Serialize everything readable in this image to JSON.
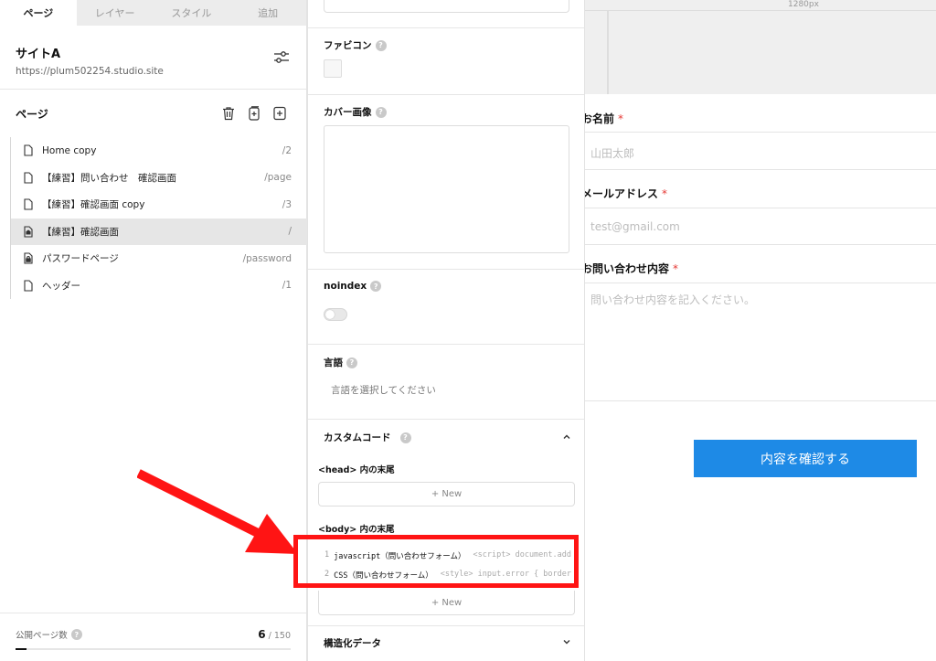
{
  "sidebar": {
    "tabs": [
      {
        "label": "ページ",
        "active": true
      },
      {
        "label": "レイヤー",
        "active": false
      },
      {
        "label": "スタイル",
        "active": false
      },
      {
        "label": "追加",
        "active": false
      }
    ],
    "site_name": "サイトA",
    "site_url": "https://plum502254.studio.site",
    "pages_title": "ページ",
    "pages": [
      {
        "name": "Home copy",
        "path": "/2",
        "icon": "page-icon",
        "selected": false
      },
      {
        "name": "【練習】問い合わせ　確認画面",
        "path": "/page",
        "icon": "page-icon",
        "selected": false
      },
      {
        "name": "【練習】確認画面 copy",
        "path": "/3",
        "icon": "page-icon",
        "selected": false
      },
      {
        "name": "【練習】確認画面",
        "path": "/",
        "icon": "home-page-icon",
        "selected": true
      },
      {
        "name": "パスワードページ",
        "path": "/password",
        "icon": "lock-icon",
        "selected": false
      },
      {
        "name": "ヘッダー",
        "path": "/1",
        "icon": "page-icon",
        "selected": false
      }
    ],
    "footer": {
      "label": "公開ページ数",
      "count": "6",
      "total": "/ 150",
      "progress": 0.04
    }
  },
  "panel": {
    "favicon_label": "ファビコン",
    "cover_label": "カバー画像",
    "noindex_label": "noindex",
    "noindex_on": false,
    "language_label": "言語",
    "language_placeholder": "言語を選択してください",
    "custom_code_label": "カスタムコード",
    "head_label": "<head> 内の末尾",
    "new_label": "+ New",
    "body_label": "<body> 内の末尾",
    "body_code": [
      {
        "line": "1",
        "name": "javascript（問い合わせフォーム）",
        "snippet": "<script> document.add"
      },
      {
        "line": "2",
        "name": "CSS（問い合わせフォーム）",
        "snippet": "<style> input.error { border"
      }
    ],
    "body_new_label": "+ New",
    "structured_label": "構造化データ"
  },
  "canvas": {
    "ruler_label": "1280px",
    "fields": [
      {
        "label": "お名前",
        "required": "*",
        "placeholder": "山田太郎"
      },
      {
        "label": "メールアドレス",
        "required": "*",
        "placeholder": "test@gmail.com"
      },
      {
        "label": "お問い合わせ内容",
        "required": "*",
        "placeholder": "問い合わせ内容を記入ください。"
      }
    ],
    "confirm_button": "内容を確認する"
  },
  "colors": {
    "accent_blue": "#1e8ae6",
    "annotation_red": "#ff1414",
    "required_red": "#e53935"
  }
}
